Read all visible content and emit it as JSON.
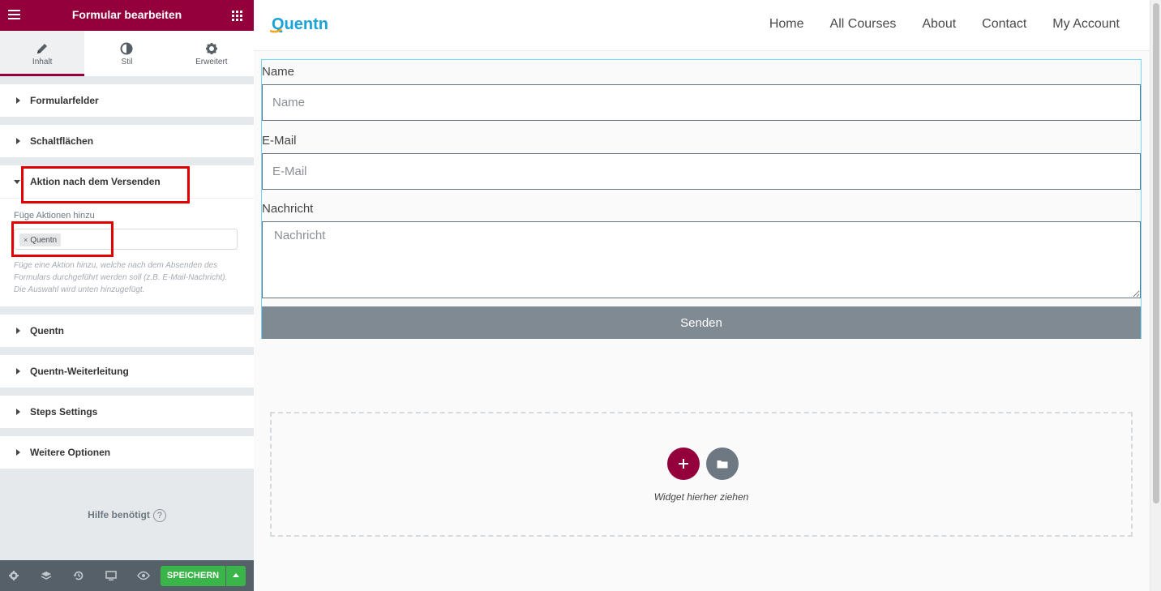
{
  "panel": {
    "title": "Formular bearbeiten",
    "tabs": [
      {
        "label": "Inhalt",
        "icon": "pencil-icon",
        "active": true
      },
      {
        "label": "Stil",
        "icon": "half-circle-icon",
        "active": false
      },
      {
        "label": "Erweitert",
        "icon": "gear-icon",
        "active": false
      }
    ],
    "sections": [
      {
        "label": "Formularfelder"
      },
      {
        "label": "Schaltflächen"
      },
      {
        "label": "Aktion nach dem Versenden"
      },
      {
        "label": "Quentn"
      },
      {
        "label": "Quentn-Weiterleitung"
      },
      {
        "label": "Steps Settings"
      },
      {
        "label": "Weitere Optionen"
      }
    ],
    "actions": {
      "label": "Füge Aktionen hinzu",
      "chip": "Quentn",
      "chip_remove": "×",
      "description": "Füge eine Aktion hinzu, welche nach dem Absenden des Formulars durchgeführt werden soll (z.B. E-Mail-Nachricht). Die Auswahl wird unten hinzugefügt."
    },
    "help": {
      "label": "Hilfe benötigt",
      "icon": "?"
    },
    "footer": {
      "save_label": "SPEICHERN"
    },
    "colors": {
      "brand": "#93003c",
      "save": "#39b54a",
      "highlight": "#e30000"
    }
  },
  "site": {
    "logo": "Quentn",
    "nav": [
      "Home",
      "All Courses",
      "About",
      "Contact",
      "My Account"
    ]
  },
  "form": {
    "fields": [
      {
        "label": "Name",
        "placeholder": "Name"
      },
      {
        "label": "E-Mail",
        "placeholder": "E-Mail"
      },
      {
        "label": "Nachricht",
        "placeholder": "Nachricht"
      }
    ],
    "submit": "Senden"
  },
  "dropzone": {
    "text": "Widget hierher ziehen"
  }
}
